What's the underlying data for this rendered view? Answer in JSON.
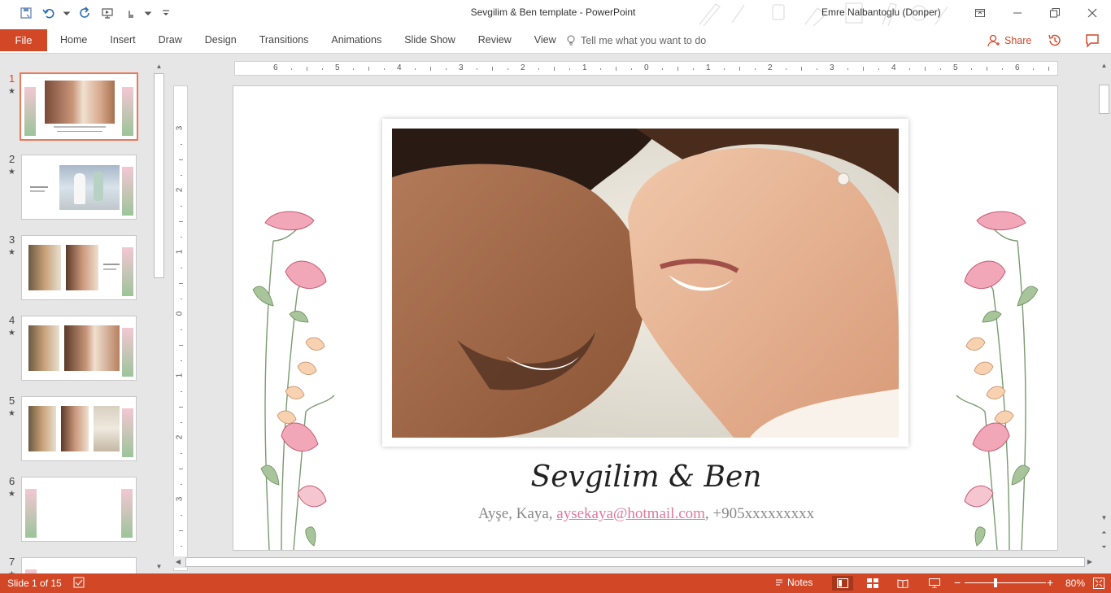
{
  "app": {
    "title": "Sevgilim & Ben template  -  PowerPoint",
    "user": "Emre Nalbantoglu (Donper)",
    "accent": "#d24726"
  },
  "qat": {
    "icons": [
      "save-icon",
      "undo-icon",
      "redo-icon",
      "start-from-beginning-icon",
      "touch-mode-icon",
      "customize-icon"
    ]
  },
  "ribbon": {
    "file": "File",
    "tabs": [
      "Home",
      "Insert",
      "Draw",
      "Design",
      "Transitions",
      "Animations",
      "Slide Show",
      "Review",
      "View"
    ],
    "tellme": "Tell me what you want to do",
    "share": "Share"
  },
  "thumbnails": [
    {
      "num": "1",
      "star": "★"
    },
    {
      "num": "2",
      "star": "★"
    },
    {
      "num": "3",
      "star": "★"
    },
    {
      "num": "4",
      "star": "★"
    },
    {
      "num": "5",
      "star": "★"
    },
    {
      "num": "6",
      "star": "★"
    },
    {
      "num": "7",
      "star": "★"
    }
  ],
  "ruler": {
    "h": [
      "6",
      "5",
      "4",
      "3",
      "2",
      "1",
      "0",
      "1",
      "2",
      "3",
      "4",
      "5",
      "6"
    ],
    "v": [
      "3",
      "2",
      "1",
      "0",
      "1",
      "2",
      "3"
    ]
  },
  "slide": {
    "title": "Sevgilim & Ben",
    "sub_prefix": "Ayşe, Kaya, ",
    "email": "aysekaya@hotmail.com",
    "sub_suffix": ", +905xxxxxxxxx"
  },
  "status": {
    "slide_count": "Slide 1 of 15",
    "notes": "Notes",
    "zoom": "80%",
    "zoom_fraction": 0.36
  }
}
